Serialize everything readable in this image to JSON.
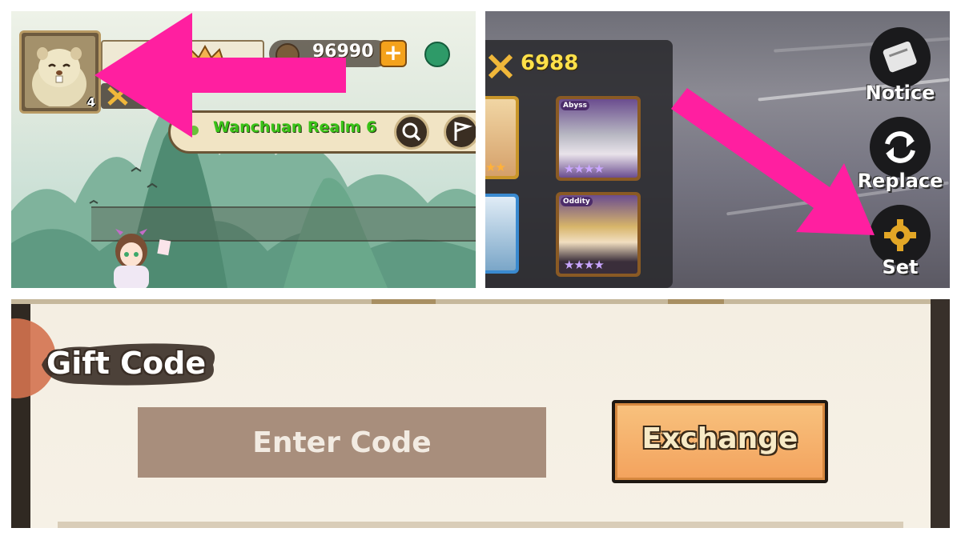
{
  "panel_top_left": {
    "player": {
      "level": "4"
    },
    "currency": {
      "coins": "96990",
      "plus_label": "+"
    },
    "realm": {
      "name": "Wanchuan Realm 6"
    }
  },
  "panel_top_right": {
    "team": {
      "power": "6988",
      "heroes": [
        {
          "badge": "",
          "stars": "★★"
        },
        {
          "badge": "Abyss",
          "stars": "★★★★"
        },
        {
          "badge": "",
          "stars": ""
        },
        {
          "badge": "Oddity",
          "stars": "★★★★"
        }
      ]
    },
    "side_menu": [
      {
        "label": "Notice",
        "icon": "scroll-icon"
      },
      {
        "label": "Replace",
        "icon": "swap-arrows-icon"
      },
      {
        "label": "Set",
        "icon": "gear-icon"
      }
    ],
    "arrow_color": "#ff1fa0"
  },
  "panel_bottom": {
    "title": "Gift Code",
    "input_placeholder": "Enter Code",
    "exchange_label": "Exchange"
  },
  "colors": {
    "highlight_arrow": "#ff1fa0",
    "exchange_button": "#f3a25d",
    "input_fill": "#a88e7c",
    "power_text": "#ffe14a",
    "realm_text": "#39c317"
  }
}
